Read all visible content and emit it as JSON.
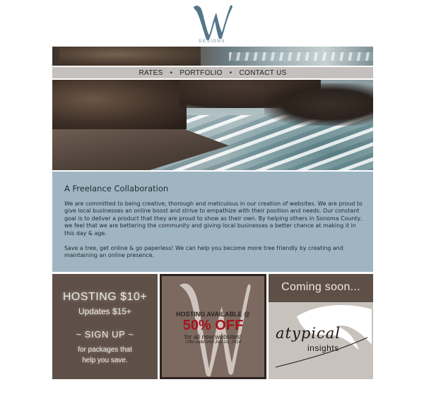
{
  "logo": {
    "letter": "W",
    "subtitle": "DESIGNS",
    "color": "#55768a"
  },
  "nav": {
    "items": [
      "RATES",
      "PORTFOLIO",
      "CONTACT US"
    ],
    "separator": "•"
  },
  "about": {
    "heading": "A Freelance Collaboration",
    "paragraph1": "We are committed to being creative, thorough and meticulous in our creation of websites. We are proud to give local businesses an online boost and strive to empathize with their position and needs. Our constant goal is to deliver a product that they are proud to show as their own. By helping others in Sonoma County, we feel that we are bettering the community and giving local businesses a better chance at making it in this day & age.",
    "paragraph2": "Save a tree, get online & go paperless! We can help you become more tree friendly by creating and maintaining an online presence."
  },
  "promo_hosting": {
    "line1": "HOSTING $10+",
    "line2": "Updates $15+",
    "line3": "~ SIGN UP ~",
    "line4": "for packages that",
    "line5": "help you save."
  },
  "promo_discount": {
    "line1": "HOSTING AVAILABLE @",
    "line2": "50% OFF",
    "line3": "for all new websites!",
    "line4": "Offer valid until July 1st, 2014",
    "accent": "#a5141c"
  },
  "promo_coming": {
    "heading": "Coming soon...",
    "brand_word1": "atypical",
    "brand_word2": "insights"
  }
}
